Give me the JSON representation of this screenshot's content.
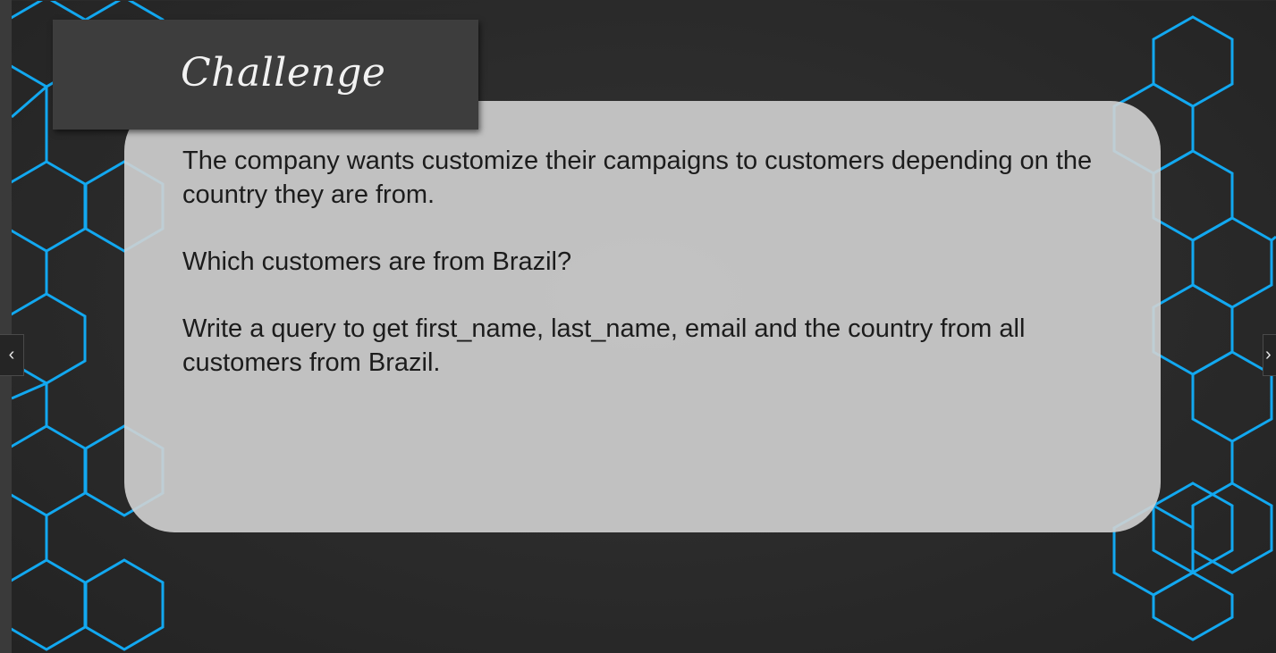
{
  "slide": {
    "title": "Challenge",
    "paragraphs": [
      "The company wants customize their campaigns to customers depending on the country they are from.",
      "Which customers are from Brazil?",
      "Write a query to get first_name, last_name, email and the country from all customers from Brazil."
    ]
  },
  "navigation": {
    "prev_icon": "chevron-left-icon",
    "next_icon": "chevron-right-icon",
    "prev_glyph": "‹",
    "next_glyph": "›"
  },
  "colors": {
    "background": "#2a2a2a",
    "accent_hex": "#12a8f0",
    "card": "#d2d2d2",
    "title_bar": "#3d3d3d"
  }
}
